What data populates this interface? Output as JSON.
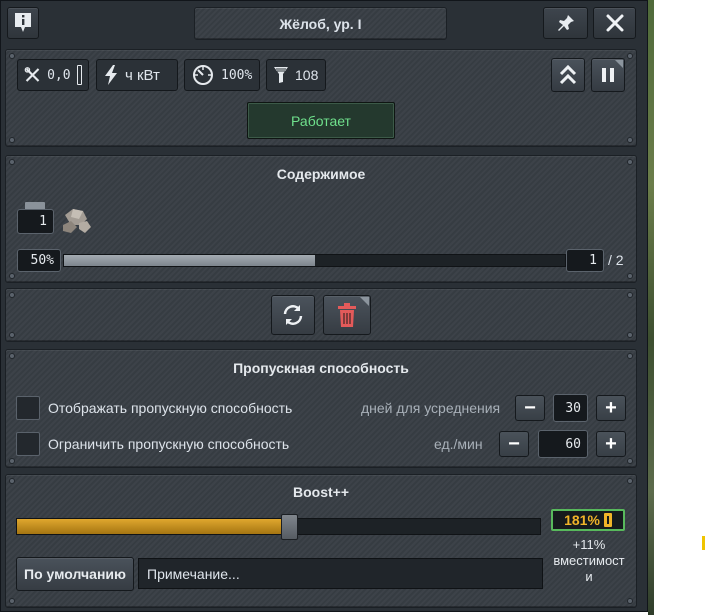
{
  "window": {
    "title": "Жёлоб, ур. I",
    "info_icon": "info-icon",
    "pin_icon": "pin-icon",
    "close_icon": "close-icon"
  },
  "stats": {
    "maintenance": "0,0",
    "power": "ч кВт",
    "efficiency": "100%",
    "throughput_filter": "108"
  },
  "status": {
    "label": "Работает",
    "color": "#6fe08c"
  },
  "contents": {
    "title": "Содержимое",
    "fill_percent_label": "50%",
    "fill_fraction": 0.5,
    "count_value": "1",
    "capacity_label": "/ 2"
  },
  "actions": {
    "swap_icon": "swap-arrows-icon",
    "delete_icon": "trash-icon"
  },
  "throughput": {
    "title": "Пропускная способность",
    "show_label": "Отображать пропускную способность",
    "show_sub_label": "дней для усреднения",
    "show_value": "30",
    "limit_label": "Ограничить пропускную способность",
    "limit_sub_label": "ед./мин",
    "limit_value": "60",
    "minus": "−",
    "plus": "+"
  },
  "boost": {
    "title": "Boost++",
    "slider_fraction": 0.52,
    "percent_label": "181%",
    "effect_label": "+11%",
    "effect_desc_1": "вместимост",
    "effect_desc_2": "и",
    "accent": "#f0b429"
  },
  "footer": {
    "default_button": "По умолчанию",
    "note_placeholder": "Примечание..."
  }
}
